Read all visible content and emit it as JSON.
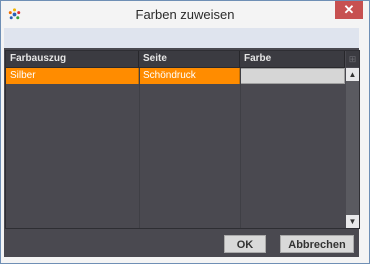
{
  "window": {
    "title": "Farben zuweisen",
    "close_glyph": "✕"
  },
  "icons": {
    "app": "color-palette-icon",
    "close": "close-icon"
  },
  "table": {
    "columns": [
      "Farbauszug",
      "Seite",
      "Farbe"
    ],
    "rows": [
      {
        "farbauszug": "Silber",
        "seite": "Schöndruck",
        "farbe": ""
      }
    ],
    "corner_glyph": "⊞",
    "scroll_up_glyph": "▲",
    "scroll_down_glyph": "▼"
  },
  "buttons": {
    "ok": "OK",
    "cancel": "Abbrechen"
  },
  "colors": {
    "selected_row": "#ff8c00",
    "panel_bg": "#4a4950",
    "close_button": "#c75050"
  }
}
